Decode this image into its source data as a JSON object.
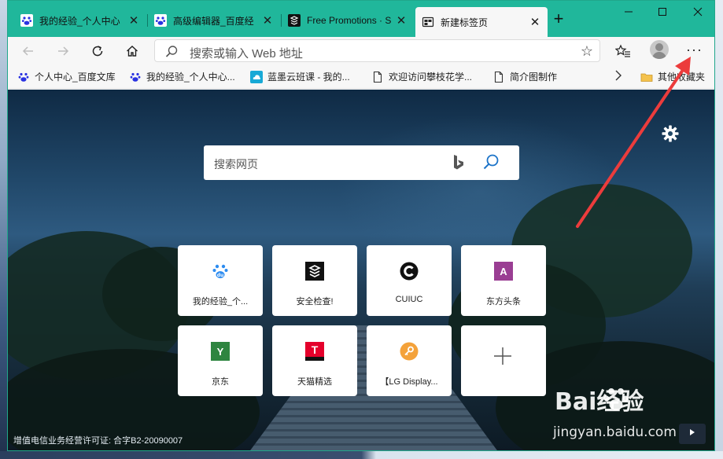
{
  "colors": {
    "titlebar": "#20b79b",
    "annotation_arrow": "#ec3c3c",
    "baidu_blue": "#2932e1"
  },
  "tabs": [
    {
      "title": "我的经验_个人中心",
      "icon": "baidu-paw-icon",
      "active": false
    },
    {
      "title": "高级编辑器_百度经",
      "icon": "baidu-paw-icon",
      "active": false
    },
    {
      "title": "Free Promotions · S",
      "icon": "promotions-icon",
      "active": false
    },
    {
      "title": "新建标签页",
      "icon": "newtab-page-icon",
      "active": true
    }
  ],
  "toolbar": {
    "address_placeholder": "搜索或输入 Web 地址"
  },
  "bookmarks": [
    {
      "label": "个人中心_百度文库",
      "icon": "baidu-paw-icon"
    },
    {
      "label": "我的经验_个人中心...",
      "icon": "baidu-paw-icon"
    },
    {
      "label": "蓝墨云班课 - 我的...",
      "icon": "cloud-icon"
    },
    {
      "label": "欢迎访问攀枝花学...",
      "icon": "page-icon"
    },
    {
      "label": "简介图制作",
      "icon": "page-icon"
    }
  ],
  "other_bookmarks": "其他收藏夹",
  "newtab": {
    "search_placeholder": "搜索网页",
    "tiles": [
      {
        "label": "我的经验_个...",
        "icon": "baidu-du-icon"
      },
      {
        "label": "安全检查!",
        "icon": "stack-icon"
      },
      {
        "label": "CUIUC",
        "icon": "c-circle-icon"
      },
      {
        "label": "东方头条",
        "icon": "letter-a-icon",
        "letter": "A"
      },
      {
        "label": "京东",
        "icon": "letter-y-icon",
        "letter": "Y"
      },
      {
        "label": "天猫精选",
        "icon": "tmall-icon",
        "letter": "T"
      },
      {
        "label": "【LG Display...",
        "icon": "key-icon"
      },
      {
        "label": "",
        "icon": "plus-icon"
      }
    ],
    "footer": "增值电信业务经营许可证: 合字B2-20090007"
  },
  "watermark": {
    "brand": "Bai经验",
    "site": "jingyan.baidu.com"
  }
}
